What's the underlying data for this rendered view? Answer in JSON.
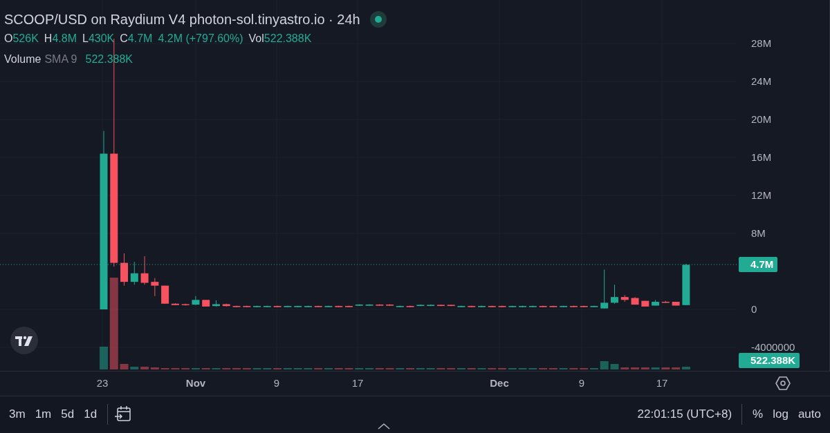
{
  "legend": {
    "title": "SCOOP/USD on Raydium V4 photon-sol.tinyastro.io · 24h",
    "ohlc": [
      {
        "label": "O",
        "value": "526K"
      },
      {
        "label": "H",
        "value": "4.8M"
      },
      {
        "label": "L",
        "value": "430K"
      },
      {
        "label": "C",
        "value": "4.7M"
      }
    ],
    "change": "4.2M (+797.60%)",
    "volume": {
      "label": "Vol",
      "value": "522.388K"
    },
    "indicator": {
      "name": "Volume",
      "params": "SMA 9",
      "value": "522.388K"
    }
  },
  "price_axis": {
    "ticks": [
      "28M",
      "24M",
      "20M",
      "16M",
      "12M",
      "8M",
      "0",
      "-4000000"
    ],
    "last_price": "4.7M",
    "last_volume": "522.388K"
  },
  "time_axis": {
    "ticks": [
      {
        "label": "23",
        "kind": "day"
      },
      {
        "label": "Nov",
        "kind": "month"
      },
      {
        "label": "9",
        "kind": "day"
      },
      {
        "label": "17",
        "kind": "day"
      },
      {
        "label": "Dec",
        "kind": "month"
      },
      {
        "label": "9",
        "kind": "day"
      },
      {
        "label": "17",
        "kind": "day"
      }
    ]
  },
  "toolbar": {
    "ranges": [
      "3m",
      "1m",
      "5d",
      "1d"
    ],
    "clock": "22:01:15 (UTC+8)",
    "options": [
      "%",
      "log",
      "auto"
    ]
  }
}
